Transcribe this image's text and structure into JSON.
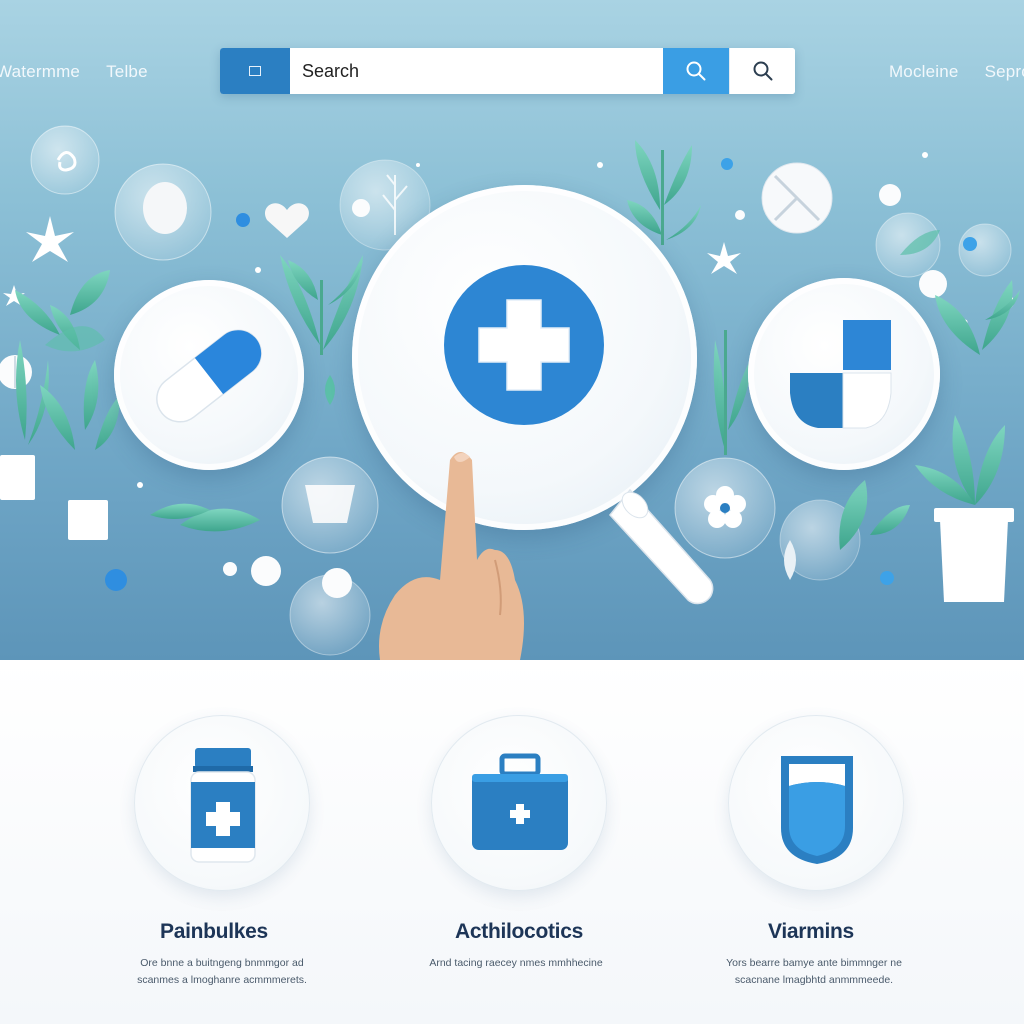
{
  "nav": {
    "left": [
      "Watermme",
      "Telbe"
    ],
    "right": [
      "Mocleine",
      "Seprc"
    ]
  },
  "search": {
    "placeholder": "Search"
  },
  "categories": [
    {
      "title": "Painbulkes",
      "description_lines": [
        "Ore bnne a buitngeng bnmmgor ad",
        "scanmes a lmoghanre acmmmerets."
      ]
    },
    {
      "title": "Acthilocotics",
      "description_lines": [
        "Arnd tacing raecey nmes mmhhecine"
      ]
    },
    {
      "title": "Viarmins",
      "description_lines": [
        "Yors bearre bamye ante bimmnger ne",
        "scacnane lmagbhtd anmmmeede."
      ]
    }
  ],
  "colors": {
    "accent": "#2b7fc2",
    "accent_light": "#3a9ee4",
    "hero_top": "#a9d3e3",
    "hero_bottom": "#5d95b9",
    "leaf": "#5bbfa8"
  }
}
